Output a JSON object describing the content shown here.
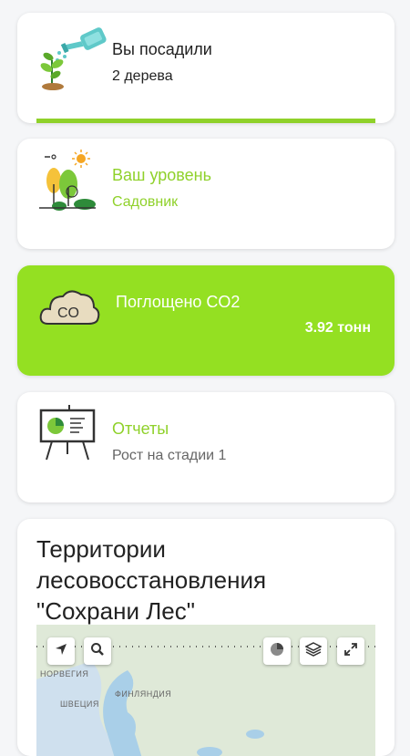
{
  "cards": [
    {
      "title": "Вы посадили",
      "subtitle": "2 дерева",
      "progress": 1.0,
      "icon": "watering-can-plant-icon"
    },
    {
      "title": "Ваш уровень",
      "subtitle": "Садовник",
      "icon": "garden-trees-sun-icon"
    },
    {
      "title": "Поглощено CO2",
      "value": "3.92 тонн",
      "icon": "co2-cloud-icon"
    },
    {
      "title": "Отчеты",
      "subtitle": "Рост на стадии 1",
      "icon": "presentation-board-icon"
    }
  ],
  "territories": {
    "title": "Территории лесовосстановления \"Сохрани Лес\"",
    "map": {
      "labels": [
        "НОРВЕГИЯ",
        "ШВЕЦИЯ",
        "ФИНЛЯНДИЯ"
      ],
      "controls": [
        "locate-arrow-icon",
        "search-icon",
        "basemap-icon",
        "layers-icon",
        "fullscreen-icon"
      ]
    }
  },
  "colors": {
    "accent": "#94e022",
    "accent_text": "#8fd12a",
    "background": "#f5f6f8"
  }
}
